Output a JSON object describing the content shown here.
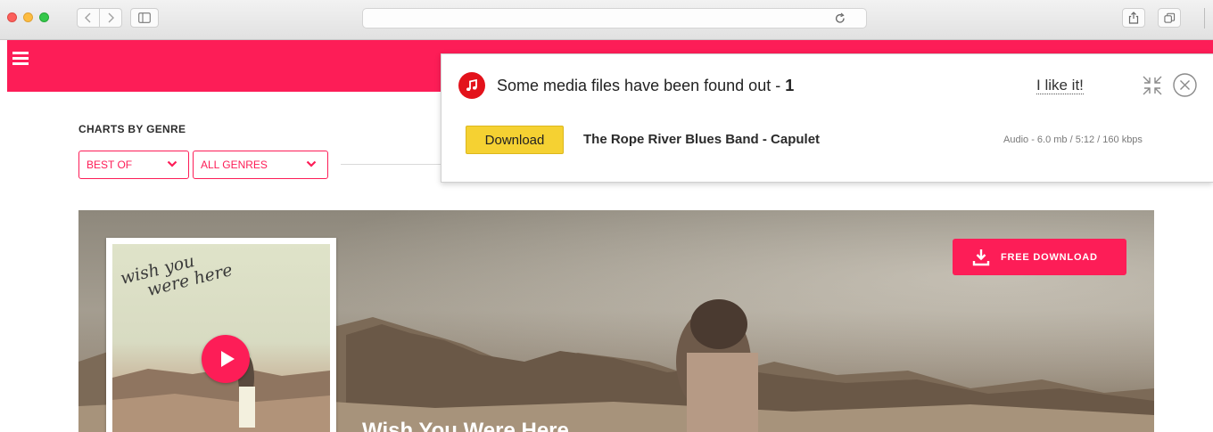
{
  "header": {
    "menu_icon": "hamburger-icon"
  },
  "charts": {
    "title": "CHARTS BY GENRE",
    "filters": [
      {
        "label": "BEST OF"
      },
      {
        "label": "ALL GENRES"
      }
    ]
  },
  "hero": {
    "free_download_label": "FREE DOWNLOAD",
    "cover_text_line1": "wish you",
    "cover_text_line2": "were here",
    "caption": "Wish You Were Here"
  },
  "popup": {
    "title_prefix": "Some media files have been found out - ",
    "count": "1",
    "like_label": "I like it!",
    "download_label": "Download",
    "track_title": "The Rope River Blues Band - Capulet",
    "track_meta": "Audio - 6.0 mb / 5:12 / 160 kbps"
  },
  "colors": {
    "brand": "#fd1d57",
    "popup_button": "#f5d132",
    "popup_icon": "#e3121b"
  }
}
